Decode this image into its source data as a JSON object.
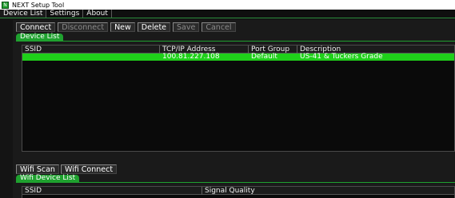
{
  "window": {
    "title": "NEXT Setup Tool",
    "app_icon": "app-icon"
  },
  "menu": {
    "tabs": [
      "Device List",
      "Settings",
      "About"
    ]
  },
  "toolbar": {
    "connect": "Connect",
    "disconnect": "Disconnect",
    "new": "New",
    "delete": "Delete",
    "save": "Save",
    "cancel": "Cancel"
  },
  "device_list": {
    "group_label": "Device List",
    "columns": [
      "SSID",
      "TCP/IP Address",
      "Port Group",
      "Description"
    ],
    "rows": [
      {
        "ssid": "",
        "ip": "100.81.227.108",
        "port_group": "Default",
        "description": "US-41 & Tuckers Grade"
      }
    ]
  },
  "wifi": {
    "scan_tab": "Wifi Scan",
    "connect_tab": "Wifi Connect",
    "group_label": "Wifi Device List",
    "columns": [
      "SSID",
      "Signal Quality"
    ]
  },
  "colors": {
    "accent": "#1fa12f",
    "selected_row": "#1fd01a",
    "background": "#141414"
  }
}
